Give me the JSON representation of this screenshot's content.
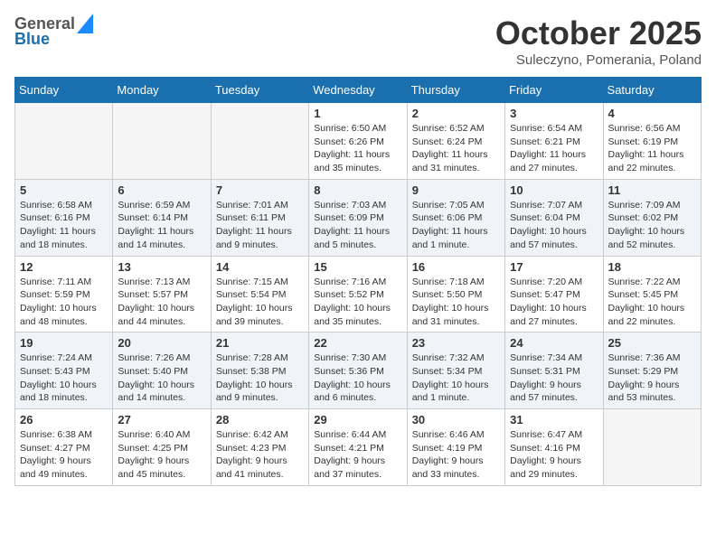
{
  "header": {
    "logo_line1": "General",
    "logo_line2": "Blue",
    "month": "October 2025",
    "location": "Suleczyno, Pomerania, Poland"
  },
  "days_of_week": [
    "Sunday",
    "Monday",
    "Tuesday",
    "Wednesday",
    "Thursday",
    "Friday",
    "Saturday"
  ],
  "weeks": [
    [
      {
        "day": "",
        "info": ""
      },
      {
        "day": "",
        "info": ""
      },
      {
        "day": "",
        "info": ""
      },
      {
        "day": "1",
        "info": "Sunrise: 6:50 AM\nSunset: 6:26 PM\nDaylight: 11 hours\nand 35 minutes."
      },
      {
        "day": "2",
        "info": "Sunrise: 6:52 AM\nSunset: 6:24 PM\nDaylight: 11 hours\nand 31 minutes."
      },
      {
        "day": "3",
        "info": "Sunrise: 6:54 AM\nSunset: 6:21 PM\nDaylight: 11 hours\nand 27 minutes."
      },
      {
        "day": "4",
        "info": "Sunrise: 6:56 AM\nSunset: 6:19 PM\nDaylight: 11 hours\nand 22 minutes."
      }
    ],
    [
      {
        "day": "5",
        "info": "Sunrise: 6:58 AM\nSunset: 6:16 PM\nDaylight: 11 hours\nand 18 minutes."
      },
      {
        "day": "6",
        "info": "Sunrise: 6:59 AM\nSunset: 6:14 PM\nDaylight: 11 hours\nand 14 minutes."
      },
      {
        "day": "7",
        "info": "Sunrise: 7:01 AM\nSunset: 6:11 PM\nDaylight: 11 hours\nand 9 minutes."
      },
      {
        "day": "8",
        "info": "Sunrise: 7:03 AM\nSunset: 6:09 PM\nDaylight: 11 hours\nand 5 minutes."
      },
      {
        "day": "9",
        "info": "Sunrise: 7:05 AM\nSunset: 6:06 PM\nDaylight: 11 hours\nand 1 minute."
      },
      {
        "day": "10",
        "info": "Sunrise: 7:07 AM\nSunset: 6:04 PM\nDaylight: 10 hours\nand 57 minutes."
      },
      {
        "day": "11",
        "info": "Sunrise: 7:09 AM\nSunset: 6:02 PM\nDaylight: 10 hours\nand 52 minutes."
      }
    ],
    [
      {
        "day": "12",
        "info": "Sunrise: 7:11 AM\nSunset: 5:59 PM\nDaylight: 10 hours\nand 48 minutes."
      },
      {
        "day": "13",
        "info": "Sunrise: 7:13 AM\nSunset: 5:57 PM\nDaylight: 10 hours\nand 44 minutes."
      },
      {
        "day": "14",
        "info": "Sunrise: 7:15 AM\nSunset: 5:54 PM\nDaylight: 10 hours\nand 39 minutes."
      },
      {
        "day": "15",
        "info": "Sunrise: 7:16 AM\nSunset: 5:52 PM\nDaylight: 10 hours\nand 35 minutes."
      },
      {
        "day": "16",
        "info": "Sunrise: 7:18 AM\nSunset: 5:50 PM\nDaylight: 10 hours\nand 31 minutes."
      },
      {
        "day": "17",
        "info": "Sunrise: 7:20 AM\nSunset: 5:47 PM\nDaylight: 10 hours\nand 27 minutes."
      },
      {
        "day": "18",
        "info": "Sunrise: 7:22 AM\nSunset: 5:45 PM\nDaylight: 10 hours\nand 22 minutes."
      }
    ],
    [
      {
        "day": "19",
        "info": "Sunrise: 7:24 AM\nSunset: 5:43 PM\nDaylight: 10 hours\nand 18 minutes."
      },
      {
        "day": "20",
        "info": "Sunrise: 7:26 AM\nSunset: 5:40 PM\nDaylight: 10 hours\nand 14 minutes."
      },
      {
        "day": "21",
        "info": "Sunrise: 7:28 AM\nSunset: 5:38 PM\nDaylight: 10 hours\nand 9 minutes."
      },
      {
        "day": "22",
        "info": "Sunrise: 7:30 AM\nSunset: 5:36 PM\nDaylight: 10 hours\nand 6 minutes."
      },
      {
        "day": "23",
        "info": "Sunrise: 7:32 AM\nSunset: 5:34 PM\nDaylight: 10 hours\nand 1 minute."
      },
      {
        "day": "24",
        "info": "Sunrise: 7:34 AM\nSunset: 5:31 PM\nDaylight: 9 hours\nand 57 minutes."
      },
      {
        "day": "25",
        "info": "Sunrise: 7:36 AM\nSunset: 5:29 PM\nDaylight: 9 hours\nand 53 minutes."
      }
    ],
    [
      {
        "day": "26",
        "info": "Sunrise: 6:38 AM\nSunset: 4:27 PM\nDaylight: 9 hours\nand 49 minutes."
      },
      {
        "day": "27",
        "info": "Sunrise: 6:40 AM\nSunset: 4:25 PM\nDaylight: 9 hours\nand 45 minutes."
      },
      {
        "day": "28",
        "info": "Sunrise: 6:42 AM\nSunset: 4:23 PM\nDaylight: 9 hours\nand 41 minutes."
      },
      {
        "day": "29",
        "info": "Sunrise: 6:44 AM\nSunset: 4:21 PM\nDaylight: 9 hours\nand 37 minutes."
      },
      {
        "day": "30",
        "info": "Sunrise: 6:46 AM\nSunset: 4:19 PM\nDaylight: 9 hours\nand 33 minutes."
      },
      {
        "day": "31",
        "info": "Sunrise: 6:47 AM\nSunset: 4:16 PM\nDaylight: 9 hours\nand 29 minutes."
      },
      {
        "day": "",
        "info": ""
      }
    ]
  ]
}
